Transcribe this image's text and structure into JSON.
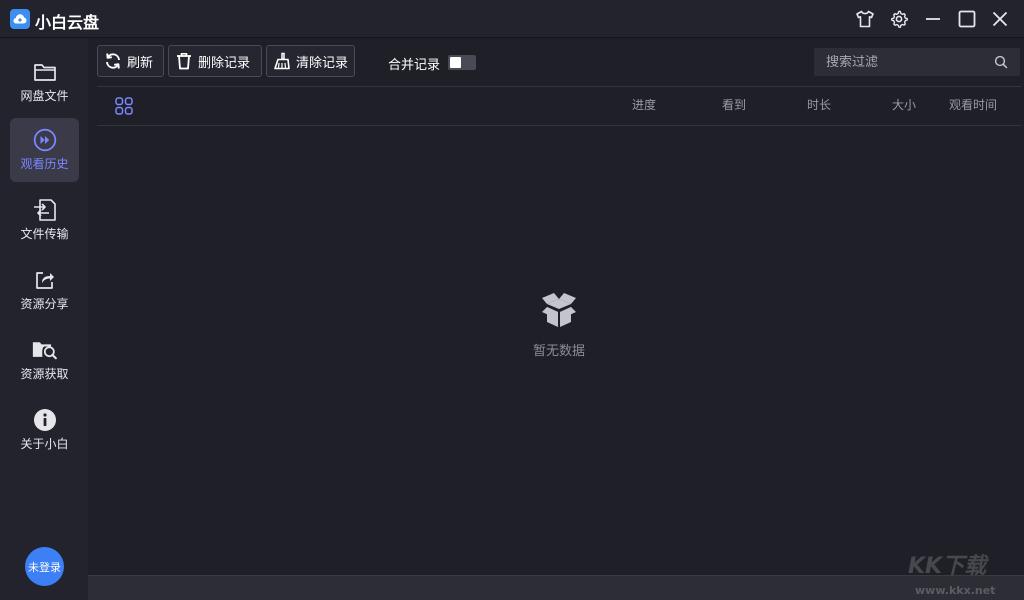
{
  "app": {
    "title": "小白云盘"
  },
  "sidebar": {
    "items": [
      {
        "label": "网盘文件",
        "icon": "folder-icon",
        "active": false
      },
      {
        "label": "观看历史",
        "icon": "play-circle-icon",
        "active": true
      },
      {
        "label": "文件传输",
        "icon": "transfer-icon",
        "active": false
      },
      {
        "label": "资源分享",
        "icon": "share-icon",
        "active": false
      },
      {
        "label": "资源获取",
        "icon": "folder-search-icon",
        "active": false
      },
      {
        "label": "关于小白",
        "icon": "info-icon",
        "active": false
      }
    ],
    "avatar_label": "未登录"
  },
  "toolbar": {
    "refresh_label": "刷新",
    "delete_label": "删除记录",
    "clear_label": "清除记录",
    "merge_label": "合并记录",
    "merge_enabled": false
  },
  "search": {
    "placeholder": "搜索过滤"
  },
  "table": {
    "columns": [
      "进度",
      "看到",
      "时长",
      "大小",
      "观看时间"
    ],
    "rows": []
  },
  "empty_state": {
    "text": "暂无数据"
  },
  "watermark": {
    "text": "KK下载",
    "url": "www.kkx.net"
  },
  "colors": {
    "background": "#1f1f28",
    "sidebar": "#23232d",
    "accent": "#7c86ff",
    "avatar": "#3d7ff5",
    "logo": "#3c8ef0"
  }
}
